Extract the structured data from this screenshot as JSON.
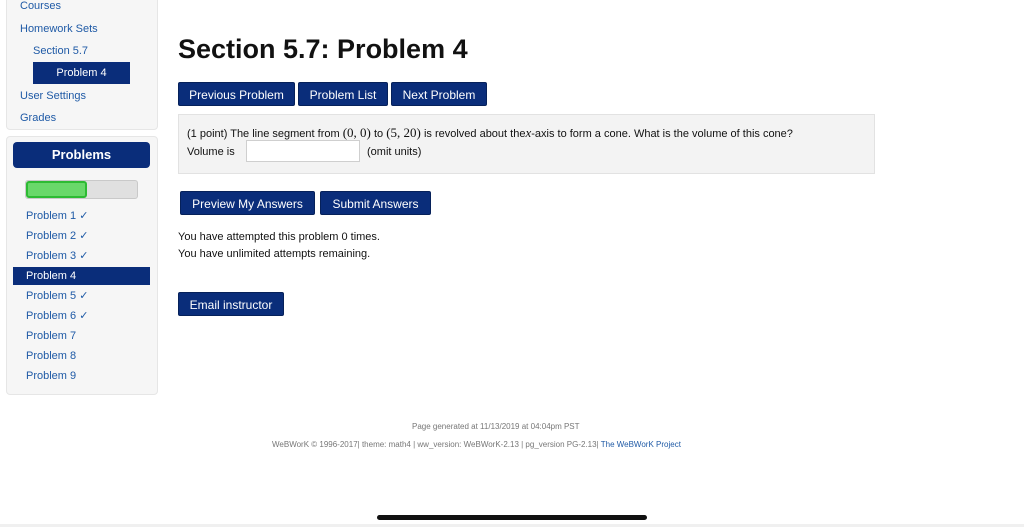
{
  "nav": {
    "courses": "Courses",
    "homework_sets": "Homework Sets",
    "section": "Section 5.7",
    "problem_active": "Problem 4",
    "user_settings": "User Settings",
    "grades": "Grades"
  },
  "problems_panel": {
    "header": "Problems",
    "progress_fraction": 0.55,
    "items": [
      {
        "label": "Problem 1 ✓"
      },
      {
        "label": "Problem 2 ✓"
      },
      {
        "label": "Problem 3 ✓"
      },
      {
        "label": "Problem 4"
      },
      {
        "label": "Problem 5 ✓"
      },
      {
        "label": "Problem 6 ✓"
      },
      {
        "label": "Problem 7"
      },
      {
        "label": "Problem 8"
      },
      {
        "label": "Problem 9"
      }
    ],
    "active_index": 3
  },
  "main": {
    "title": "Section 5.7: Problem 4",
    "buttons": {
      "previous": "Previous Problem",
      "list": "Problem List",
      "next": "Next Problem"
    },
    "problem": {
      "points": "(1 point)",
      "text_1": "The line segment from",
      "math_1": "(0, 0)",
      "text_2": "to",
      "math_2": "(5, 20)",
      "text_3": "is revolved about the",
      "math_3": "x",
      "text_4": "-axis to form a cone. What is the volume of this cone?",
      "answer_label": "Volume is",
      "answer_value": "",
      "answer_units": "(omit units)"
    },
    "actions": {
      "preview": "Preview My Answers",
      "submit": "Submit Answers"
    },
    "attempts_line_1": "You have attempted this problem 0 times.",
    "attempts_line_2": "You have unlimited attempts remaining.",
    "email_button": "Email instructor"
  },
  "footer": {
    "generated": "Page generated at 11/13/2019 at 04:04pm PST",
    "version_prefix": "WeBWorK © 1996-2017| theme: math4 | ww_version: WeBWorK-2.13 | pg_version PG-2.13|",
    "project_link": "The WeBWorK Project"
  },
  "colors": {
    "primary": "#0a2d7a",
    "link": "#1f5aa6",
    "progress": "#69d86a"
  }
}
